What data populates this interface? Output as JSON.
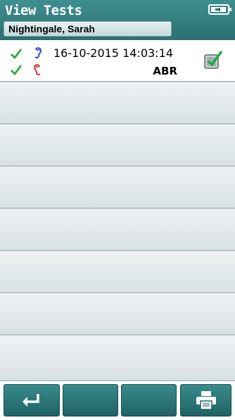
{
  "header": {
    "title": "View Tests",
    "patient_name": "Nightingale, Sarah"
  },
  "tests": [
    {
      "datetime": "16-10-2015 14:03:14",
      "type": "ABR",
      "left_ear_pass": true,
      "right_ear_pass": true,
      "selected": true
    }
  ],
  "colors": {
    "header_teal": "#2b6f71",
    "pass_check": "#1aa83a",
    "right_ear": "#2233cc",
    "left_ear": "#cc2222"
  },
  "toolbar": {
    "back_icon": "return-arrow-icon",
    "print_icon": "printer-icon"
  }
}
